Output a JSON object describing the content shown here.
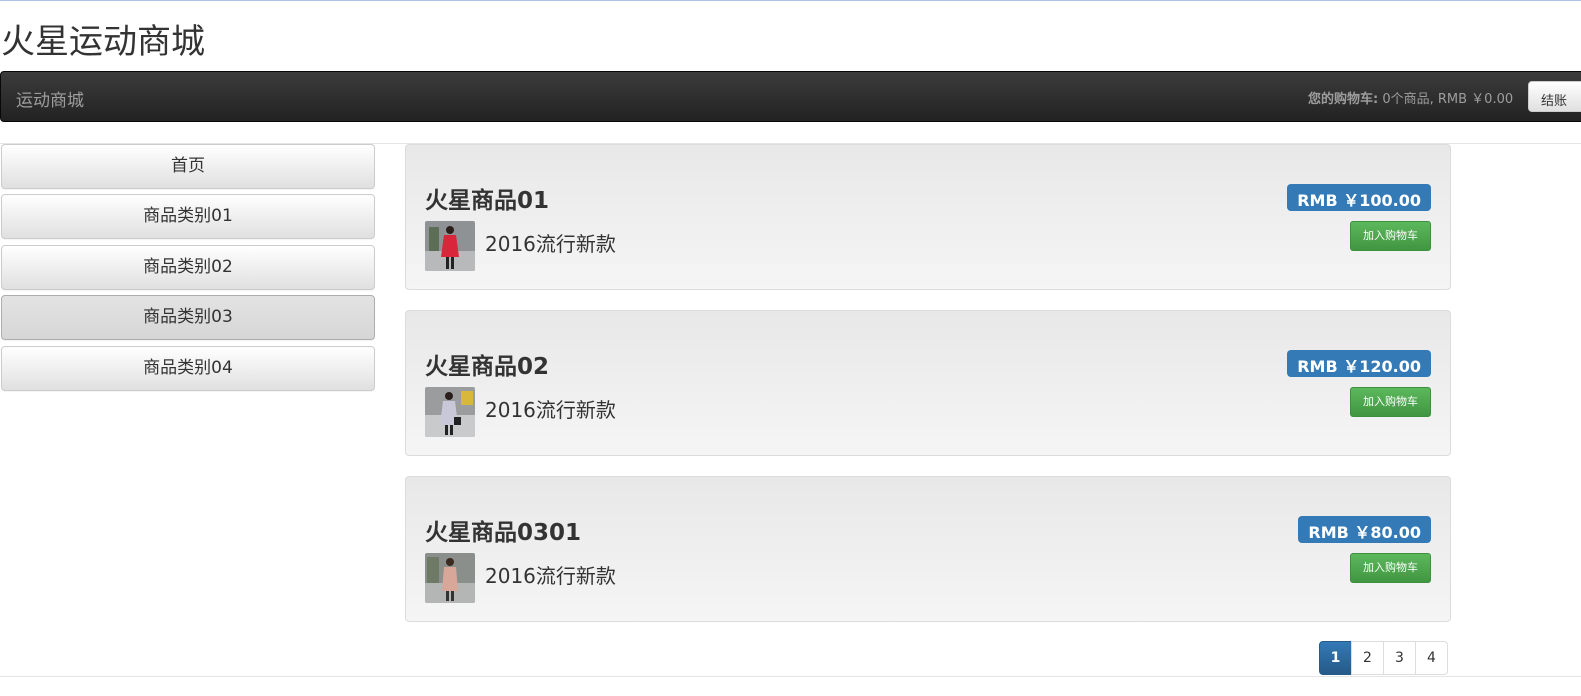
{
  "site": {
    "title": "火星运动商城"
  },
  "navbar": {
    "brand": "运动商城",
    "cart_label": "您的购物车:",
    "cart_summary": "0个商品, RMB ￥0.00",
    "checkout_label": "结账"
  },
  "sidebar": {
    "items": [
      {
        "label": "首页",
        "active": false
      },
      {
        "label": "商品类别01",
        "active": false
      },
      {
        "label": "商品类别02",
        "active": false
      },
      {
        "label": "商品类别03",
        "active": true
      },
      {
        "label": "商品类别04",
        "active": false
      }
    ]
  },
  "products": [
    {
      "name": "火星商品01",
      "description": "2016流行新款",
      "price": "RMB ￥100.00",
      "add_label": "加入购物车",
      "thumb_color": "#d9263b"
    },
    {
      "name": "火星商品02",
      "description": "2016流行新款",
      "price": "RMB ￥120.00",
      "add_label": "加入购物车",
      "thumb_color": "#c8c8d8"
    },
    {
      "name": "火星商品0301",
      "description": "2016流行新款",
      "price": "RMB ￥80.00",
      "add_label": "加入购物车",
      "thumb_color": "#d8a79a"
    }
  ],
  "pagination": {
    "pages": [
      "1",
      "2",
      "3",
      "4"
    ],
    "current": "1"
  },
  "colors": {
    "navbar": "#222222",
    "price_badge": "#337ab7",
    "add_button": "#449d44",
    "page_current": "#2e6da4"
  }
}
